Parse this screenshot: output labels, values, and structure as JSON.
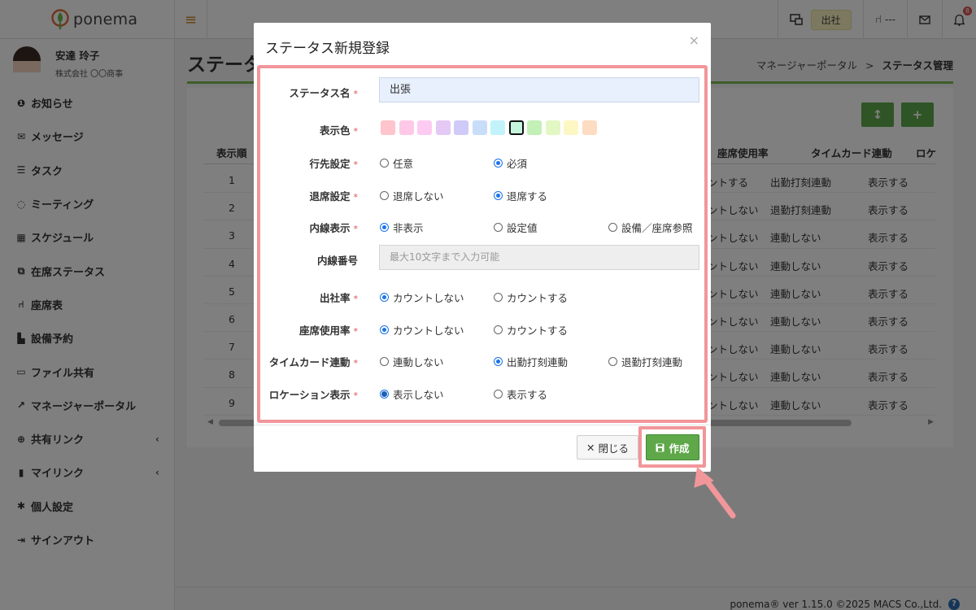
{
  "app": {
    "logo_text": "ponema"
  },
  "topbar": {
    "status_label": "出社",
    "seat_label": "---",
    "notification_count": "8"
  },
  "user": {
    "name": "安達 玲子",
    "company": "株式会社 〇〇商事"
  },
  "sidebar": {
    "items": [
      {
        "label": "お知らせ",
        "icon": "info-icon"
      },
      {
        "label": "メッセージ",
        "icon": "envelope-icon"
      },
      {
        "label": "タスク",
        "icon": "list-icon"
      },
      {
        "label": "ミーティング",
        "icon": "chat-icon"
      },
      {
        "label": "スケジュール",
        "icon": "calendar-icon"
      },
      {
        "label": "在席ステータス",
        "icon": "presence-icon"
      },
      {
        "label": "座席表",
        "icon": "chair-icon"
      },
      {
        "label": "設備予約",
        "icon": "equipment-icon"
      },
      {
        "label": "ファイル共有",
        "icon": "folder-icon"
      },
      {
        "label": "マネージャーポータル",
        "icon": "chart-icon"
      },
      {
        "label": "共有リンク",
        "icon": "globe-icon"
      },
      {
        "label": "マイリンク",
        "icon": "bookmark-icon"
      },
      {
        "label": "個人設定",
        "icon": "gear-icon"
      },
      {
        "label": "サインアウト",
        "icon": "signout-icon"
      }
    ]
  },
  "page": {
    "title": "ステータス管理",
    "breadcrumb_parent": "マネージャーポータル",
    "breadcrumb_sep": ">",
    "breadcrumb_current": "ステータス管理"
  },
  "table": {
    "headers": [
      "表示順",
      "座席使用率",
      "タイムカード連動",
      "ロケ"
    ],
    "rows": [
      {
        "order": "1",
        "seat": "ントする",
        "timecard": "出勤打刻連動",
        "loc": "表示する"
      },
      {
        "order": "2",
        "seat": "ントしない",
        "timecard": "退勤打刻連動",
        "loc": "表示する"
      },
      {
        "order": "3",
        "seat": "ントしない",
        "timecard": "連動しない",
        "loc": "表示する"
      },
      {
        "order": "4",
        "seat": "ントしない",
        "timecard": "連動しない",
        "loc": "表示する"
      },
      {
        "order": "5",
        "seat": "ントしない",
        "timecard": "連動しない",
        "loc": "表示する"
      },
      {
        "order": "6",
        "seat": "ントしない",
        "timecard": "連動しない",
        "loc": "表示する"
      },
      {
        "order": "7",
        "seat": "ントしない",
        "timecard": "連動しない",
        "loc": "表示する"
      },
      {
        "order": "8",
        "seat": "ントしない",
        "timecard": "連動しない",
        "loc": "表示する"
      },
      {
        "order": "9",
        "seat": "ントしない",
        "timecard": "連動しない",
        "loc": "表示する"
      }
    ]
  },
  "footer": {
    "text": "ponema® ver 1.15.0 ©2025 MACS Co.,Ltd."
  },
  "modal": {
    "title": "ステータス新規登録",
    "required_mark": "*",
    "status_name": {
      "label": "ステータス名",
      "value": "出張"
    },
    "color": {
      "label": "表示色",
      "swatches": [
        "#ffc4cc",
        "#ffc8e6",
        "#fdcbf2",
        "#e4c9f5",
        "#cfcaf7",
        "#c8ddf8",
        "#c2f3fb",
        "#c6f5de",
        "#c3f0b6",
        "#e3f7c4",
        "#fdf7c4",
        "#fddcc1"
      ],
      "selected_index": 7
    },
    "destination": {
      "label": "行先設定",
      "options": [
        "任意",
        "必須"
      ],
      "selected": "必須"
    },
    "leave": {
      "label": "退席設定",
      "options": [
        "退席しない",
        "退席する"
      ],
      "selected": "退席する"
    },
    "extension_display": {
      "label": "内線表示",
      "options": [
        "非表示",
        "設定値",
        "設備／座席参照"
      ],
      "selected": "非表示"
    },
    "extension_number": {
      "label": "内線番号",
      "placeholder": "最大10文字まで入力可能"
    },
    "attendance_rate": {
      "label": "出社率",
      "options": [
        "カウントしない",
        "カウントする"
      ],
      "selected": "カウントしない"
    },
    "seat_rate": {
      "label": "座席使用率",
      "options": [
        "カウントしない",
        "カウントする"
      ],
      "selected": "カウントしない"
    },
    "timecard": {
      "label": "タイムカード連動",
      "options": [
        "連動しない",
        "出勤打刻連動",
        "退勤打刻連動"
      ],
      "selected": "出勤打刻連動"
    },
    "location": {
      "label": "ロケーション表示",
      "options": [
        "表示しない",
        "表示する"
      ],
      "selected": "表示しない"
    },
    "close_button": "閉じる",
    "create_button": "作成"
  }
}
